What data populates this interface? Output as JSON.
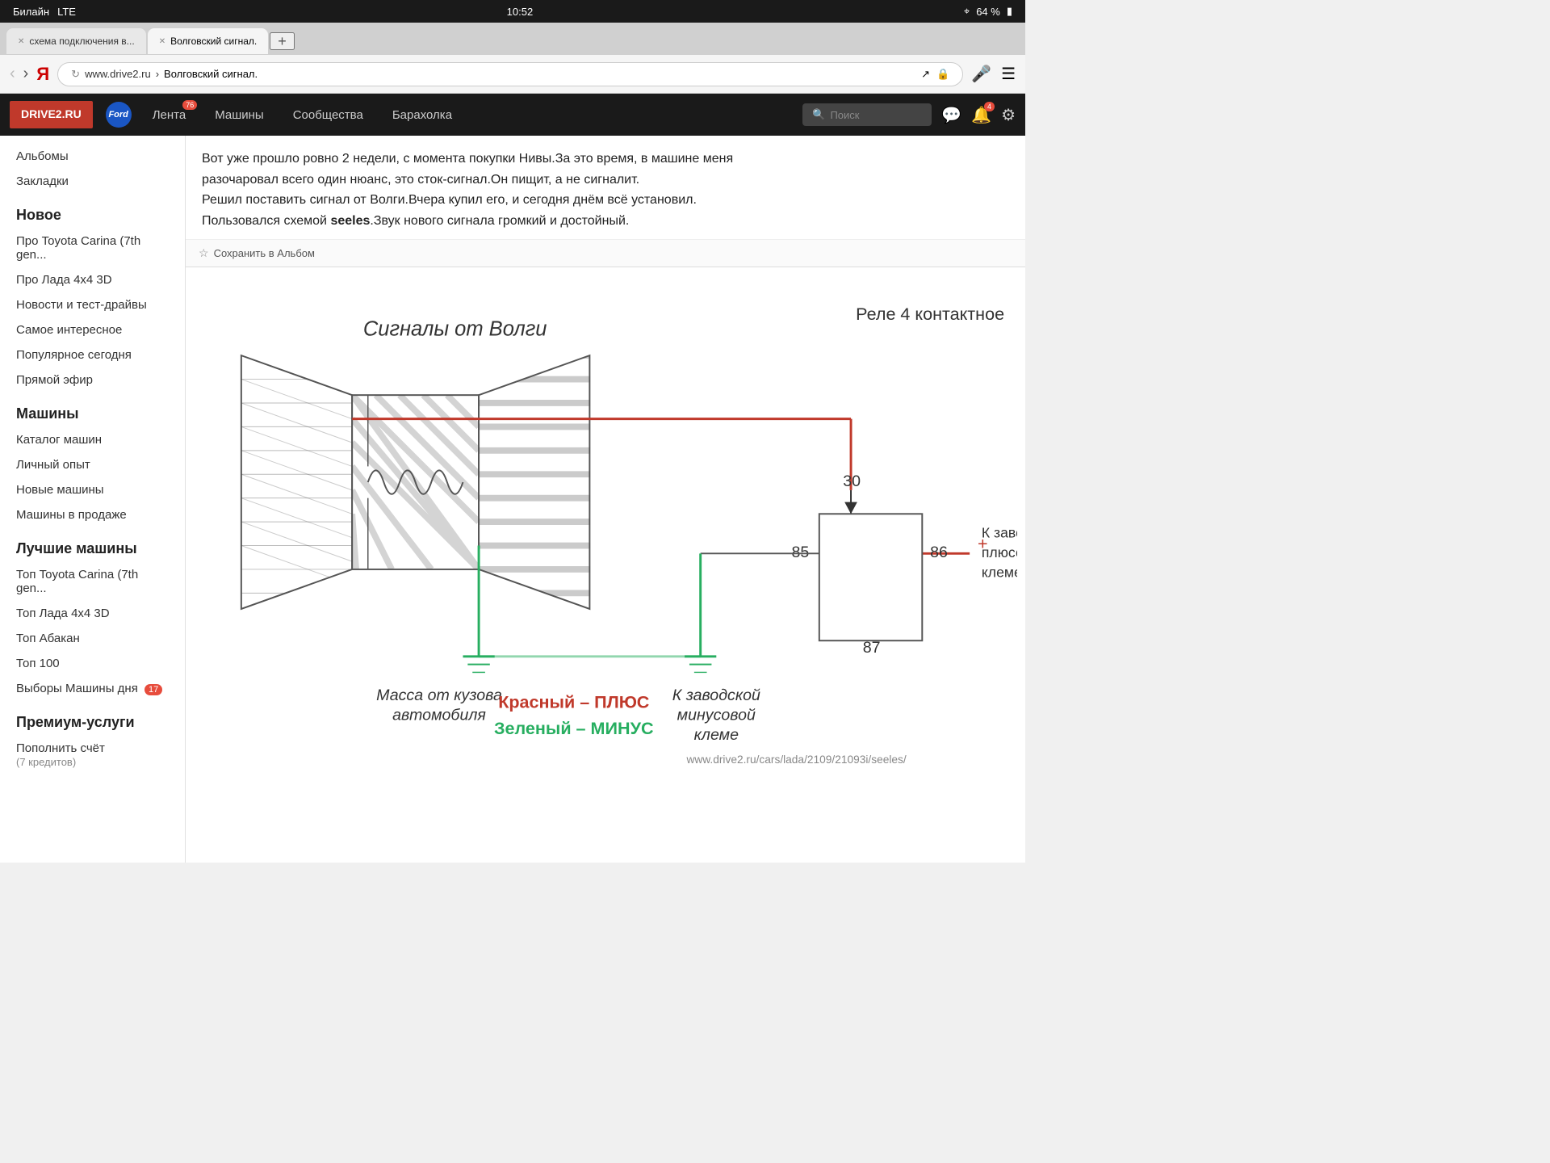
{
  "status_bar": {
    "carrier": "Билайн",
    "network": "LTE",
    "time": "10:52",
    "battery": "64 %",
    "gps_icon": "location-arrow"
  },
  "tabs": [
    {
      "label": "схема подключения в...",
      "active": false
    },
    {
      "label": "Волговский сигнал.",
      "active": true
    }
  ],
  "new_tab_label": "+",
  "address_bar": {
    "back": "‹",
    "forward": "›",
    "yandex": "Я",
    "url_domain": "www.drive2.ru",
    "url_separator": "›",
    "url_path": "Волговский сигнал.",
    "reload_icon": "↻",
    "lock_icon": "🔒"
  },
  "nav": {
    "logo": "DRIVE2.RU",
    "ford_label": "Ford",
    "items": [
      {
        "label": "Лента",
        "badge": "76"
      },
      {
        "label": "Машины",
        "badge": null
      },
      {
        "label": "Сообщества",
        "badge": null
      },
      {
        "label": "Барахолка",
        "badge": null
      }
    ],
    "search_placeholder": "Поиск",
    "messages_badge": null,
    "notifications_badge": "4"
  },
  "sidebar": {
    "top_items": [
      {
        "label": "Альбомы"
      },
      {
        "label": "Закладки"
      }
    ],
    "sections": [
      {
        "title": "Новое",
        "items": [
          {
            "label": "Про Toyota Carina (7th gen..."
          },
          {
            "label": "Про Лада 4x4 3D"
          },
          {
            "label": "Новости и тест-драйвы"
          },
          {
            "label": "Самое интересное"
          },
          {
            "label": "Популярное сегодня"
          },
          {
            "label": "Прямой эфир"
          }
        ]
      },
      {
        "title": "Машины",
        "items": [
          {
            "label": "Каталог машин"
          },
          {
            "label": "Личный опыт"
          },
          {
            "label": "Новые машины"
          },
          {
            "label": "Машины в продаже"
          }
        ]
      },
      {
        "title": "Лучшие машины",
        "items": [
          {
            "label": "Топ Toyota Carina (7th gen..."
          },
          {
            "label": "Топ Лада 4x4 3D"
          },
          {
            "label": "Топ Абакан"
          },
          {
            "label": "Топ 100"
          },
          {
            "label": "Выборы Машины дня",
            "badge": "17"
          }
        ]
      },
      {
        "title": "Премиум-услуги",
        "items": [
          {
            "label": "Пополнить счёт\n(7 кредитов)"
          }
        ]
      }
    ]
  },
  "article": {
    "text_lines": [
      "Вот уже прошло ровно 2 недели, с момента покупки Нивы.За это время, в машине меня",
      "разочаровал всего один нюанс, это сток-сигнал.Он пищит, а не сигналит.",
      "Решил поставить сигнал от Волги.Вчера купил его, и сегодня днём всё установил.",
      "Пользовался схемой seeles.Звук нового сигнала громкий и достойный."
    ],
    "author_bold": "seeles"
  },
  "save_album_label": "Сохранить в Альбом",
  "diagram": {
    "title_signals": "Сигналы от Волги",
    "title_relay": "Реле 4 контактное",
    "label_30": "30",
    "label_85": "85",
    "label_86": "86",
    "label_87": "87",
    "label_ground": "Масса от кузова\nавтомобиля",
    "label_minus": "К заводской\nминусовой\nклеме",
    "label_plus": "К заводской\nплюсовой\nклеме",
    "label_red": "Красный – ПЛЮС",
    "label_green": "Зеленый – МИНУС",
    "watermark": "www.drive2.ru/cars/lada/2109/21093i/seeles/"
  }
}
